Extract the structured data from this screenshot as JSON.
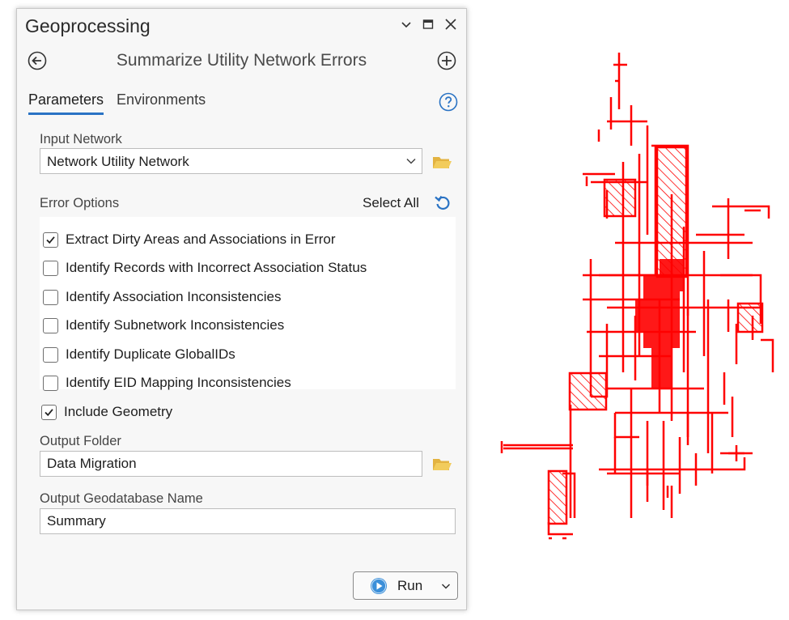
{
  "panel": {
    "title": "Geoprocessing",
    "tool_title": "Summarize Utility Network Errors",
    "tabs": [
      {
        "label": "Parameters",
        "active": true
      },
      {
        "label": "Environments",
        "active": false
      }
    ],
    "input_network": {
      "label": "Input Network",
      "value": "Network Utility Network"
    },
    "error_options": {
      "label": "Error Options",
      "select_all_label": "Select All",
      "items": [
        {
          "label": "Extract Dirty Areas and Associations in Error",
          "checked": true
        },
        {
          "label": "Identify Records with Incorrect Association Status",
          "checked": false
        },
        {
          "label": "Identify Association Inconsistencies",
          "checked": false
        },
        {
          "label": "Identify Subnetwork Inconsistencies",
          "checked": false
        },
        {
          "label": "Identify Duplicate GlobalIDs",
          "checked": false
        },
        {
          "label": "Identify EID Mapping Inconsistencies",
          "checked": false
        }
      ]
    },
    "include_geometry": {
      "label": "Include Geometry",
      "checked": true
    },
    "output_folder": {
      "label": "Output Folder",
      "value": "Data Migration"
    },
    "output_gdb": {
      "label": "Output Geodatabase Name",
      "value": "Summary"
    },
    "run_label": "Run"
  },
  "colors": {
    "accent": "#2a73c4",
    "error_features": "#ff0000",
    "folder": "#e3b341"
  },
  "icons": [
    "chevron-down-icon",
    "maximize-icon",
    "close-icon",
    "back-arrow-icon",
    "add-icon",
    "help-icon",
    "folder-icon",
    "refresh-icon",
    "play-icon"
  ]
}
